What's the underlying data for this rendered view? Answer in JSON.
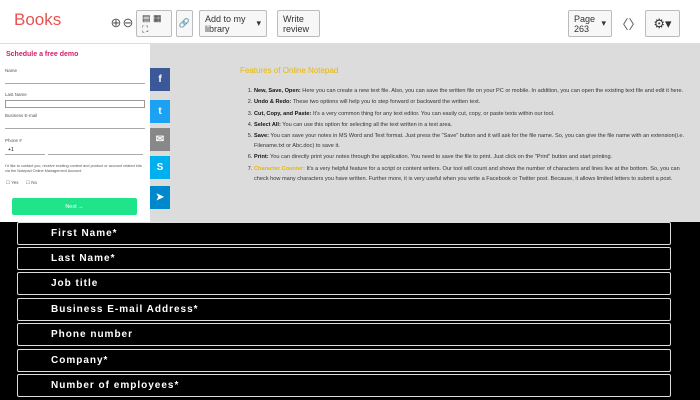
{
  "toolbar": {
    "brand": "Books",
    "add_library": "Add to my library",
    "write_review": "Write review",
    "page": "Page 263",
    "prev": "〈",
    "next": "〉",
    "settings_icon": "gear-icon"
  },
  "form": {
    "title": "Schedule a free demo",
    "first_name_label": "Name",
    "last_name_label": "Last Name",
    "email_label": "Business E-mail",
    "phone_label": "Phone #",
    "country_code": "+1",
    "consent_text": "I'd like to contact you, receive exciting content and product or account related info via the Notepad Online Management Account",
    "yes_label": "Yes",
    "no_label": "No",
    "next_button": "Next →"
  },
  "document": {
    "heading": "Features of Online Notepad",
    "items": [
      {
        "title": "New, Save, Open:",
        "text": " Here you can create a new text file. Also, you can save the written file on your PC or mobile. In addition, you can open the existing text file and edit it here."
      },
      {
        "title": "Undo & Redo:",
        "text": " These two options will help you to step forward or backward the written text."
      },
      {
        "title": "Cut, Copy, and Paste:",
        "text": " It's a very common thing for any text editor. You can easily cut, copy, or paste texts within our tool."
      },
      {
        "title": "Select All:",
        "text": " You can use this option for selecting all the text written in a text area."
      },
      {
        "title": "Save:",
        "text": " You can save your notes in MS Word and Text format. Just press the \"Save\" button and it will ask for the file name. So, you can give the file name with an extension(i.e. Filename.txt or Abc.doc) to save it."
      },
      {
        "title": "Print:",
        "text": " You can directly print your notes through the application. You need to save the file to print. Just click on the \"Print\" button and start printing."
      },
      {
        "title": "Character Counter:",
        "text": " It's a very helpful feature for a script or content writers. Our tool will count and shows the number of characters and lines live at the bottom. So, you can check how many characters you have written. Further more, it is very useful when you write a Facebook or Twitter post. Because, it allows limited letters to submit a post."
      }
    ]
  },
  "share": {
    "facebook": "f",
    "twitter": "t",
    "email": "✉",
    "skype": "S",
    "telegram": "➤",
    "colors": {
      "facebook": "#3b5998",
      "twitter": "#1da1f2",
      "email": "#888888",
      "skype": "#00aff0",
      "telegram": "#0088cc"
    }
  },
  "bottom_form": {
    "fields": [
      "First Name*",
      "Last Name*",
      "Job title",
      "Business E-mail Address*",
      "Phone number",
      "Company*",
      "Number of employees*"
    ]
  }
}
